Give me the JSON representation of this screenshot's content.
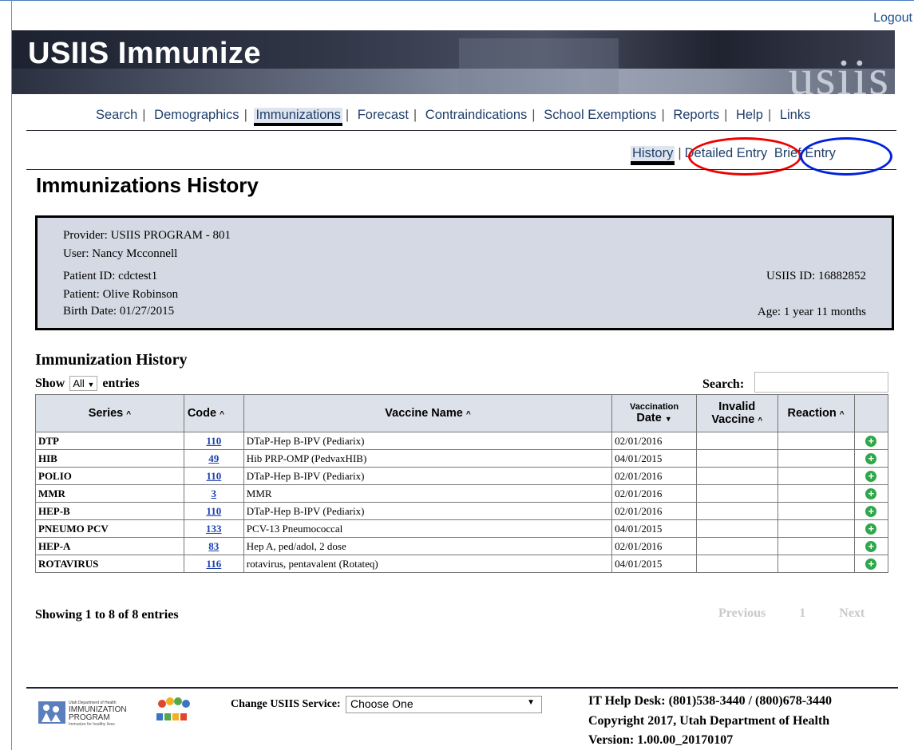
{
  "header": {
    "logout": "Logout",
    "app_title": "USIIS Immunize",
    "watermark": "usiis"
  },
  "main_nav": [
    {
      "label": "Search",
      "active": false
    },
    {
      "label": "Demographics",
      "active": false
    },
    {
      "label": "Immunizations",
      "active": true
    },
    {
      "label": "Forecast",
      "active": false
    },
    {
      "label": "Contraindications",
      "active": false
    },
    {
      "label": "School Exemptions",
      "active": false
    },
    {
      "label": "Reports",
      "active": false
    },
    {
      "label": "Help",
      "active": false
    },
    {
      "label": "Links",
      "active": false
    }
  ],
  "sub_nav": {
    "history": "History",
    "detailed": "Detailed Entry",
    "brief": "Brief Entry"
  },
  "page_title": "Immunizations History",
  "patient": {
    "provider": "Provider: USIIS PROGRAM - 801",
    "user": "User: Nancy Mcconnell",
    "patient_id": "Patient ID: cdctest1",
    "patient_name": "Patient: Olive Robinson",
    "birth_date": "Birth Date: 01/27/2015",
    "usiis_id": "USIIS ID: 16882852",
    "age": "Age: 1 year 11 months"
  },
  "history": {
    "heading": "Immunization History",
    "show_prefix": "Show",
    "show_value": "All",
    "show_suffix": "entries",
    "search_label": "Search:",
    "columns": {
      "series": "Series",
      "code": "Code",
      "vaccine": "Vaccine Name",
      "date_top": "Vaccination",
      "date": "Date",
      "invalid_top": "Invalid",
      "invalid": "Vaccine",
      "reaction": "Reaction"
    },
    "rows": [
      {
        "series": "DTP",
        "code": "110",
        "vaccine": "DTaP-Hep B-IPV (Pediarix)",
        "date": "02/01/2016"
      },
      {
        "series": "HIB",
        "code": "49",
        "vaccine": "Hib PRP-OMP (PedvaxHIB)",
        "date": "04/01/2015"
      },
      {
        "series": "POLIO",
        "code": "110",
        "vaccine": "DTaP-Hep B-IPV (Pediarix)",
        "date": "02/01/2016"
      },
      {
        "series": "MMR",
        "code": "3",
        "vaccine": "MMR",
        "date": "02/01/2016"
      },
      {
        "series": "HEP-B",
        "code": "110",
        "vaccine": "DTaP-Hep B-IPV (Pediarix)",
        "date": "02/01/2016"
      },
      {
        "series": "PNEUMO PCV",
        "code": "133",
        "vaccine": "PCV-13 Pneumococcal",
        "date": "04/01/2015"
      },
      {
        "series": "HEP-A",
        "code": "83",
        "vaccine": "Hep A, ped/adol, 2 dose",
        "date": "02/01/2016"
      },
      {
        "series": "ROTAVIRUS",
        "code": "116",
        "vaccine": "rotavirus, pentavalent (Rotateq)",
        "date": "04/01/2015"
      }
    ],
    "showing": "Showing 1 to 8 of 8 entries",
    "pager": {
      "previous": "Previous",
      "page": "1",
      "next": "Next"
    }
  },
  "footer": {
    "logo_text_1": "Utah Department of Health",
    "logo_text_2": "IMMUNIZATION",
    "logo_text_3": "PROGRAM",
    "logo_text_4": "Immunize for healthy lives",
    "change_label": "Change USIIS Service:",
    "change_value": "Choose One",
    "helpdesk": "IT Help Desk: (801)538-3440 / (800)678-3440",
    "copyright": "Copyright 2017, Utah Department of Health",
    "version": "Version: 1.00.00_20170107"
  },
  "colors": {
    "accent_red": "#e00000",
    "accent_blue": "#0022dd",
    "link": "#1a3fb0"
  }
}
